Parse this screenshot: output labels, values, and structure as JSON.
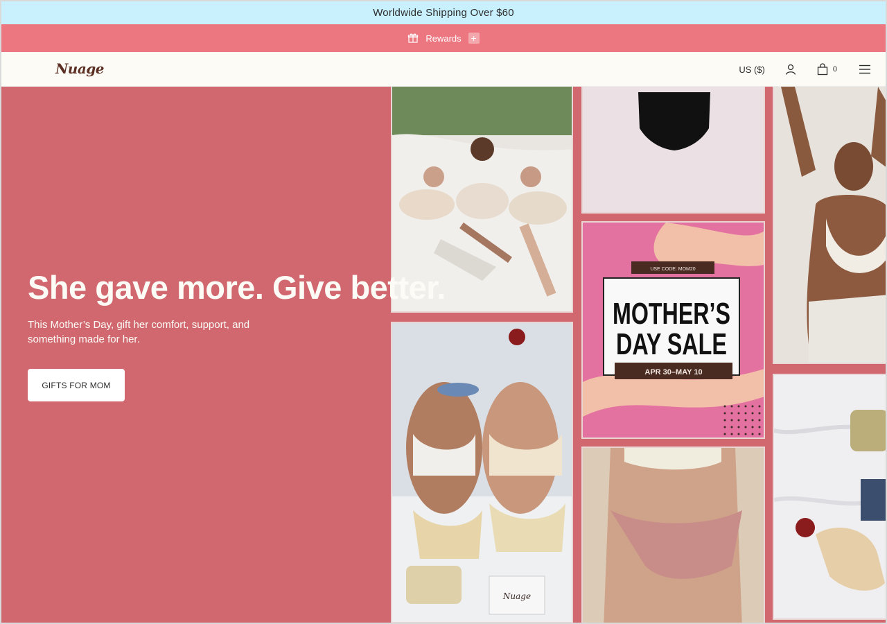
{
  "announcement": {
    "text": "Worldwide Shipping Over $60"
  },
  "rewards": {
    "label": "Rewards",
    "toggle_symbol": "+"
  },
  "header": {
    "logo_text": "Nuage",
    "currency": "US ($)",
    "cart_count": "0",
    "icons": [
      "gift-icon",
      "account-icon",
      "cart-icon",
      "menu-icon"
    ]
  },
  "hero": {
    "title": "She gave more. Give better.",
    "subtitle": "This Mother’s Day, gift her comfort, support, and something made for her.",
    "cta_label": "GIFTS FOR MOM"
  },
  "promo_tile": {
    "code_label": "USE CODE: MOM20",
    "headline_line1": "MOTHER’S",
    "headline_line2": "DAY SALE",
    "dates": "APR 30–MAY 10"
  },
  "product_box_text": "Nuage",
  "colors": {
    "announcement_bg": "#c9f1fd",
    "rewards_bg": "#ec7780",
    "header_bg": "#fcfbf6",
    "hero_bg": "#d16870",
    "promo_pink": "#e472a0",
    "logo_brown": "#5b2f23"
  }
}
